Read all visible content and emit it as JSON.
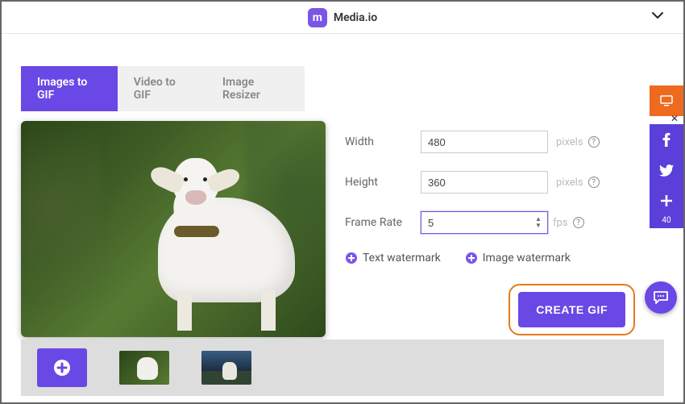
{
  "brand": {
    "name": "Media.io",
    "logo_letter": "m"
  },
  "tabs": [
    {
      "label": "Images to GIF",
      "active": true
    },
    {
      "label": "Video to GIF",
      "active": false
    },
    {
      "label": "Image Resizer",
      "active": false
    }
  ],
  "form": {
    "width": {
      "label": "Width",
      "value": "480",
      "unit": "pixels"
    },
    "height": {
      "label": "Height",
      "value": "360",
      "unit": "pixels"
    },
    "frame_rate": {
      "label": "Frame Rate",
      "value": "5",
      "unit": "fps"
    }
  },
  "watermarks": {
    "text": "Text watermark",
    "image": "Image watermark"
  },
  "cta": "CREATE GIF",
  "rail": {
    "share_count": "40"
  }
}
